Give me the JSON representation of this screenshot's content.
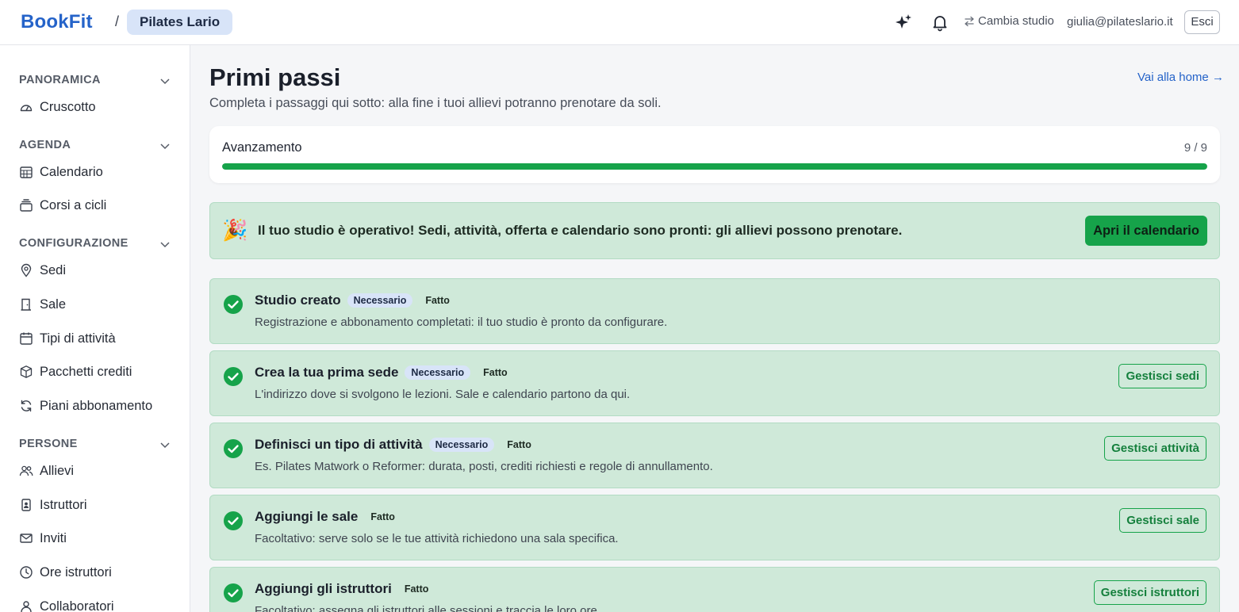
{
  "header": {
    "logo": "BookFit",
    "separator": "/",
    "studio": "Pilates Lario",
    "switch_label": "Cambia studio",
    "user_email": "giulia@pilateslario.it",
    "logout_label": "Esci",
    "icons": [
      "sparkle-icon",
      "bell-icon",
      "swap-icon"
    ]
  },
  "sidebar": {
    "sections": [
      {
        "label": "PANORAMICA",
        "items": [
          {
            "label": "Cruscotto",
            "icon": "gauge-icon"
          }
        ]
      },
      {
        "label": "AGENDA",
        "items": [
          {
            "label": "Calendario",
            "icon": "calendar-grid-icon"
          },
          {
            "label": "Corsi a cicli",
            "icon": "stack-icon"
          }
        ]
      },
      {
        "label": "CONFIGURAZIONE",
        "items": [
          {
            "label": "Sedi",
            "icon": "map-pin-icon"
          },
          {
            "label": "Sale",
            "icon": "door-icon"
          },
          {
            "label": "Tipi di attività",
            "icon": "calendar-icon"
          },
          {
            "label": "Pacchetti crediti",
            "icon": "package-icon"
          },
          {
            "label": "Piani abbonamento",
            "icon": "refresh-icon"
          }
        ]
      },
      {
        "label": "PERSONE",
        "items": [
          {
            "label": "Allievi",
            "icon": "users-icon"
          },
          {
            "label": "Istruttori",
            "icon": "badge-icon"
          },
          {
            "label": "Inviti",
            "icon": "mail-icon"
          },
          {
            "label": "Ore istruttori",
            "icon": "clock-icon"
          },
          {
            "label": "Collaboratori",
            "icon": "user-icon"
          }
        ]
      }
    ]
  },
  "main": {
    "title": "Primi passi",
    "subtitle": "Completa i passaggi qui sotto: alla fine i tuoi allievi potranno prenotare da soli.",
    "home_link": "Vai alla home →",
    "progress": {
      "label": "Avanzamento",
      "count": "9 / 9",
      "completed": 9,
      "total": 9
    },
    "banner": {
      "emoji": "🎉",
      "text": "Il tuo studio è operativo! Sedi, attività, offerta e calendario sono pronti: gli allievi possono prenotare.",
      "button": "Apri il calendario"
    },
    "steps": [
      {
        "title": "Studio creato",
        "required": "Necessario",
        "status": "Fatto",
        "desc": "Registrazione e abbonamento completati: il tuo studio è pronto da configurare.",
        "button": ""
      },
      {
        "title": "Crea la tua prima sede",
        "required": "Necessario",
        "status": "Fatto",
        "desc": "L'indirizzo dove si svolgono le lezioni. Sale e calendario partono da qui.",
        "button": "Gestisci sedi"
      },
      {
        "title": "Definisci un tipo di attività",
        "required": "Necessario",
        "status": "Fatto",
        "desc": "Es. Pilates Matwork o Reformer: durata, posti, crediti richiesti e regole di annullamento.",
        "button": "Gestisci attività"
      },
      {
        "title": "Aggiungi le sale",
        "required": "",
        "status": "Fatto",
        "desc": "Facoltativo: serve solo se le tue attività richiedono una sala specifica.",
        "button": "Gestisci sale"
      },
      {
        "title": "Aggiungi gli istruttori",
        "required": "",
        "status": "Fatto",
        "desc": "Facoltativo: assegna gli istruttori alle sessioni e traccia le loro ore.",
        "button": "Gestisci istruttori"
      }
    ]
  },
  "colors": {
    "brand": "#2563c9",
    "success": "#16a34a",
    "success_bg": "#cfe9d9",
    "badge_bg": "#d8e4f8"
  }
}
